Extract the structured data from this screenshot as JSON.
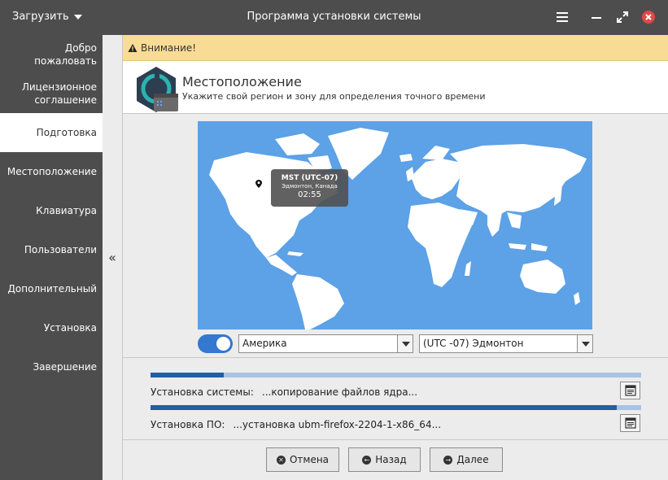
{
  "titlebar": {
    "load_label": "Загрузить",
    "title": "Программа установки системы"
  },
  "sidebar": {
    "items": [
      {
        "label": "Добро\nпожаловать",
        "active": false
      },
      {
        "label": "Лицензионное\nсоглашение",
        "active": false
      },
      {
        "label": "Подготовка",
        "active": true
      },
      {
        "label": "Местоположение",
        "active": false
      },
      {
        "label": "Клавиатура",
        "active": false
      },
      {
        "label": "Пользователи",
        "active": false
      },
      {
        "label": "Дополнительный",
        "active": false
      },
      {
        "label": "Установка",
        "active": false
      },
      {
        "label": "Завершение",
        "active": false
      }
    ],
    "collapse_glyph": "«"
  },
  "warning": {
    "text": "Внимание!"
  },
  "header": {
    "title": "Местоположение",
    "subtitle": "Укажите свой регион и зону для определения точного времени"
  },
  "map": {
    "tooltip": {
      "tz": "MST (UTC-07)",
      "city": "Эдмонтон, Канада",
      "time": "02:55"
    }
  },
  "location": {
    "toggle_on": true,
    "region": "Америка",
    "zone": "(UTC -07) Эдмонтон"
  },
  "progress": {
    "system": {
      "label": "Установка системы:",
      "value": "...копирование файлов ядра...",
      "fraction": 0.15
    },
    "software": {
      "label": "Установка ПО:",
      "value": "...установка ubm-firefox-2204-1-x86_64...",
      "fraction": 0.95
    }
  },
  "buttons": {
    "cancel": "Отмена",
    "back": "Назад",
    "next": "Далее"
  },
  "colors": {
    "sidebar_bg": "#4d4d4d",
    "accent": "#3478d0",
    "map_water": "#5da1e6",
    "warning_bg": "#f8dc96",
    "close": "#e04848"
  }
}
